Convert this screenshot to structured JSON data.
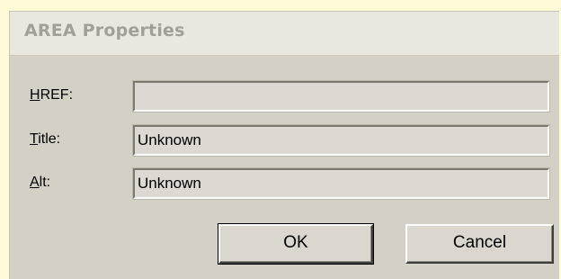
{
  "dialog": {
    "title": "AREA Properties"
  },
  "fields": {
    "href": {
      "label_accel": "H",
      "label_rest": "REF:",
      "value": ""
    },
    "title": {
      "label_accel": "T",
      "label_rest": "itle:",
      "value": "Unknown"
    },
    "alt": {
      "label_accel": "A",
      "label_rest": "lt:",
      "value": "Unknown"
    }
  },
  "buttons": {
    "ok_label": "OK",
    "cancel_label": "Cancel"
  },
  "colors": {
    "page_background": "#fdfbd8",
    "dialog_background": "#d5d0c6",
    "field_background": "#ded8d2",
    "title_text": "#a29f99"
  }
}
